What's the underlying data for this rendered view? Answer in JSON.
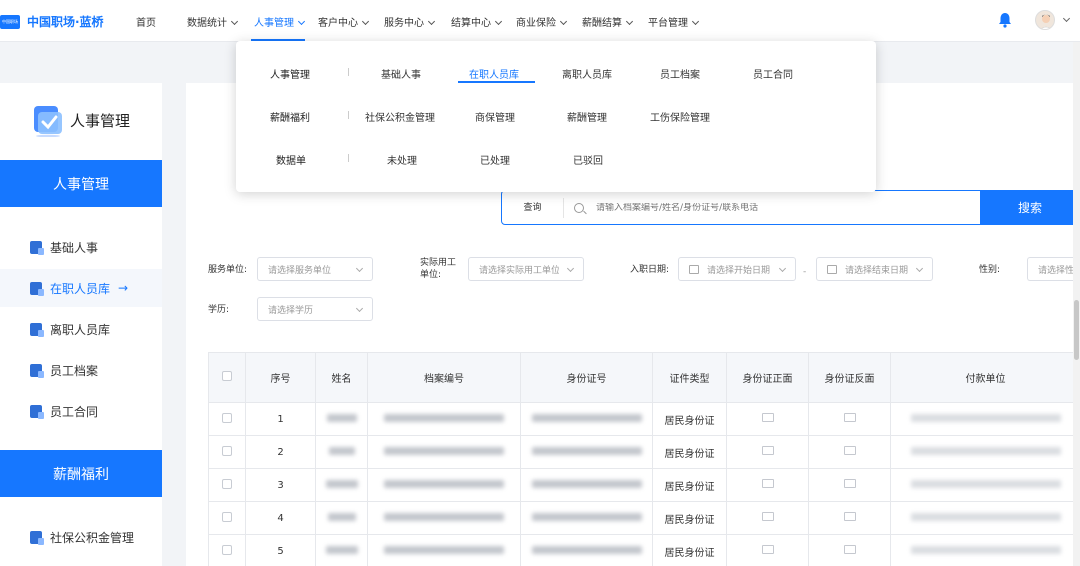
{
  "brand": {
    "name": "中国职场·蓝桥",
    "mark": "中国职场"
  },
  "nav": {
    "home": "首页",
    "items": [
      {
        "label": "数据统计"
      },
      {
        "label": "人事管理"
      },
      {
        "label": "客户中心"
      },
      {
        "label": "服务中心"
      },
      {
        "label": "结算中心"
      },
      {
        "label": "商业保险"
      },
      {
        "label": "薪酬结算"
      },
      {
        "label": "平台管理"
      }
    ],
    "active_index": 1
  },
  "mega_menu": {
    "rows": [
      {
        "category": "人事管理",
        "links": [
          "基础人事",
          "在职人员库",
          "离职人员库",
          "员工档案",
          "员工合同"
        ]
      },
      {
        "category": "薪酬福利",
        "links": [
          "社保公积金管理",
          "商保管理",
          "薪酬管理",
          "工伤保险管理"
        ]
      },
      {
        "category": "数据单",
        "links": [
          "未处理",
          "已处理",
          "已驳回"
        ]
      }
    ],
    "active": "在职人员库"
  },
  "sidebar": {
    "title": "人事管理",
    "section1": "人事管理",
    "items1": [
      {
        "label": "基础人事"
      },
      {
        "label": "在职人员库"
      },
      {
        "label": "离职人员库"
      },
      {
        "label": "员工档案"
      },
      {
        "label": "员工合同"
      }
    ],
    "active_arrow": "→",
    "section2": "薪酬福利",
    "items2": [
      {
        "label": "社保公积金管理"
      }
    ]
  },
  "search": {
    "type": "查询",
    "placeholder": "请输入档案编号/姓名/身份证号/联系电话",
    "button": "搜索"
  },
  "filters": {
    "service_unit": {
      "label": "服务单位:",
      "placeholder": "请选择服务单位"
    },
    "actual_unit": {
      "label": "实际用工单位:",
      "label_l1": "实际用工",
      "label_l2": "单位:",
      "placeholder": "请选择实际用工单位"
    },
    "entry_date": {
      "label": "入职日期:",
      "start": "请选择开始日期",
      "sep": "-",
      "end": "请选择结束日期"
    },
    "gender": {
      "label": "性别:",
      "placeholder": "请选择性别"
    },
    "education": {
      "label": "学历:",
      "placeholder": "请选择学历"
    }
  },
  "table": {
    "headers": [
      "序号",
      "姓名",
      "档案编号",
      "身份证号",
      "证件类型",
      "身份证正面",
      "身份证反面",
      "付款单位"
    ],
    "rows": [
      {
        "no": "1",
        "id_type": "居民身份证"
      },
      {
        "no": "2",
        "id_type": "居民身份证"
      },
      {
        "no": "3",
        "id_type": "居民身份证"
      },
      {
        "no": "4",
        "id_type": "居民身份证"
      },
      {
        "no": "5",
        "id_type": "居民身份证"
      }
    ]
  },
  "colors": {
    "primary": "#1677ff",
    "text": "#333333",
    "border": "#e6e8ec"
  }
}
